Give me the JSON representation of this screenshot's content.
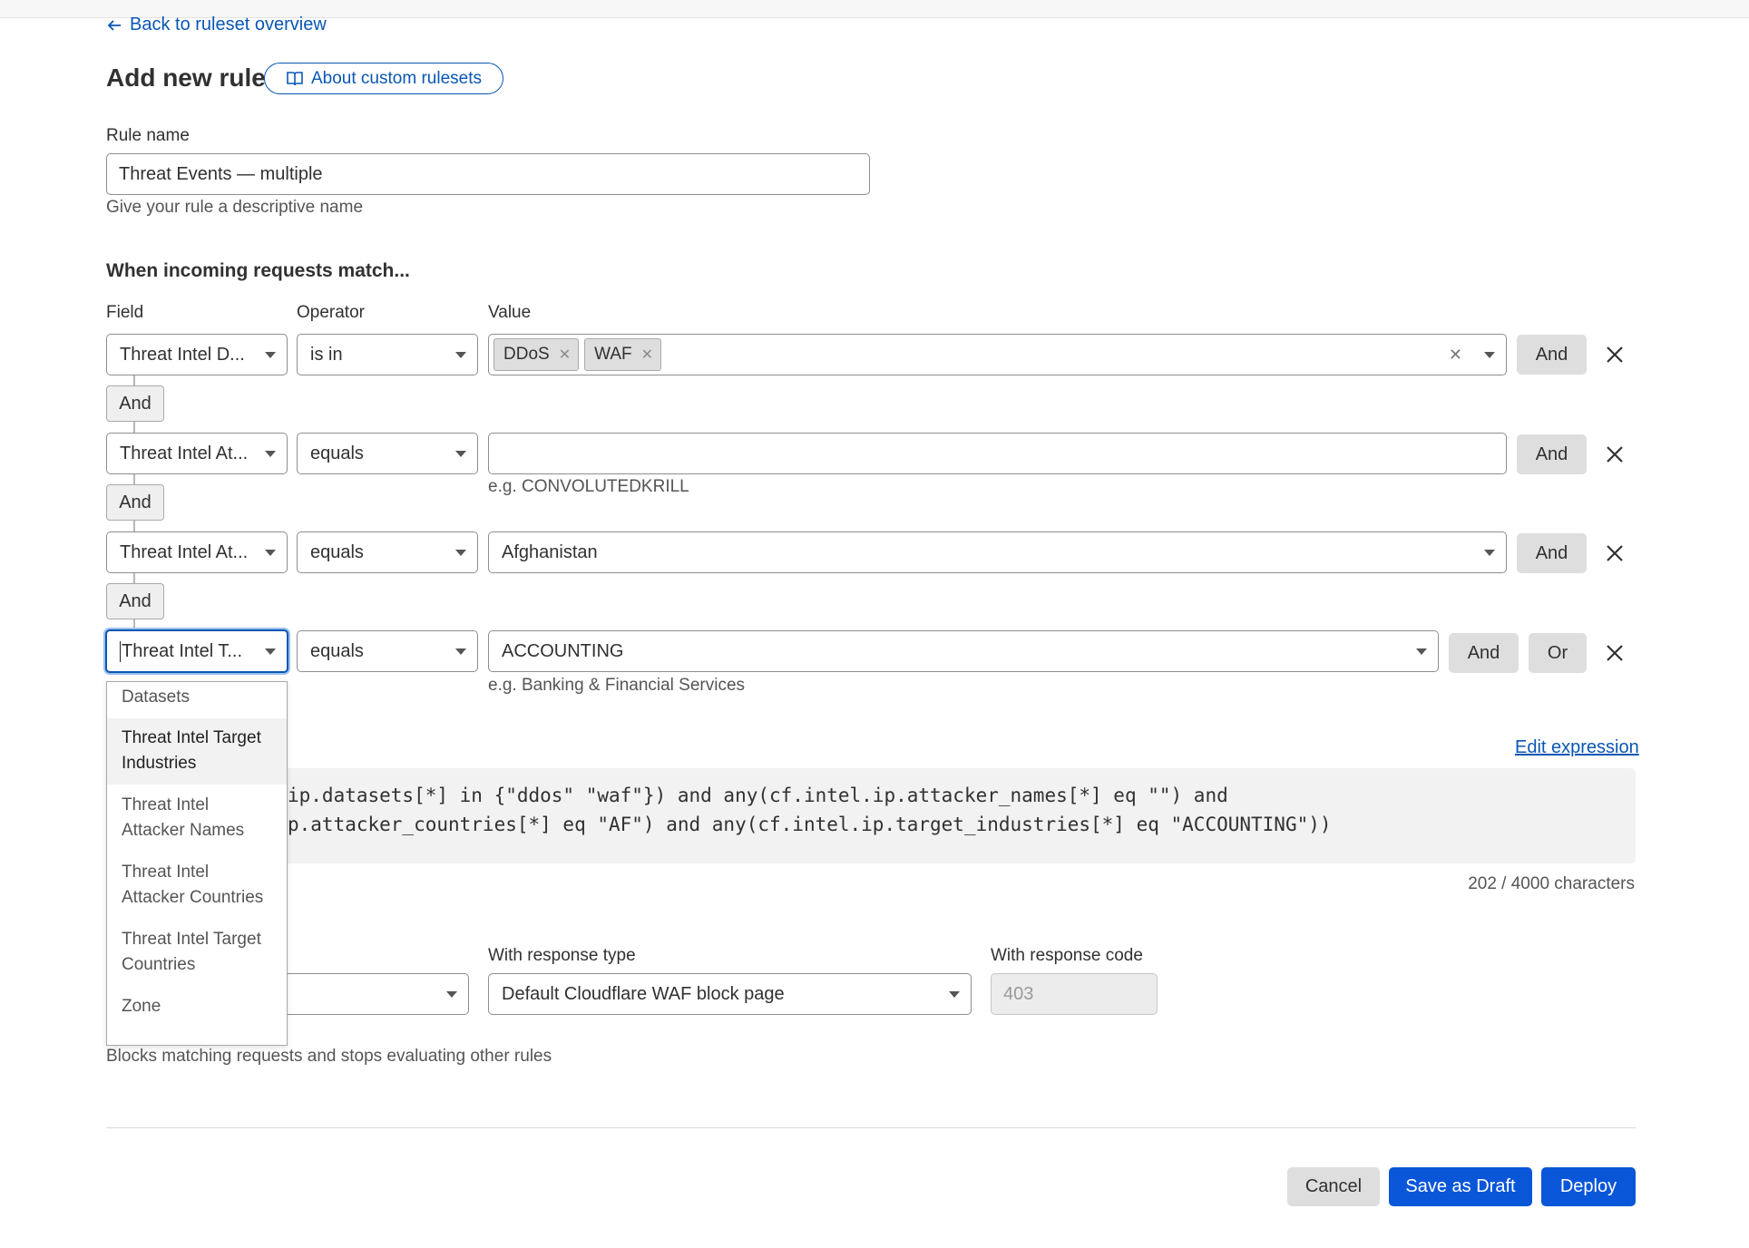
{
  "nav": {
    "back_label": "Back to ruleset overview"
  },
  "header": {
    "title": "Add new rule",
    "about_label": "About custom rulesets"
  },
  "rule_name": {
    "label": "Rule name",
    "value": "Threat Events — multiple",
    "helper": "Give your rule a descriptive name"
  },
  "match": {
    "title": "When incoming requests match...",
    "col_field": "Field",
    "col_operator": "Operator",
    "col_value": "Value",
    "rows": [
      {
        "field": "Threat Intel D...",
        "operator": "is in",
        "tags": [
          "DDoS",
          "WAF"
        ],
        "and_label": "And"
      },
      {
        "field": "Threat Intel At...",
        "operator": "equals",
        "value": "",
        "helper": "e.g. CONVOLUTEDKRILL",
        "and_label": "And"
      },
      {
        "field": "Threat Intel At...",
        "operator": "equals",
        "value": "Afghanistan",
        "and_label": "And"
      },
      {
        "field": "Threat Intel T...",
        "operator": "equals",
        "value": "ACCOUNTING",
        "helper": "e.g. Banking & Financial Services",
        "and_label": "And",
        "or_label": "Or"
      }
    ],
    "connectors": [
      "And",
      "And",
      "And"
    ]
  },
  "field_dropdown": {
    "items": [
      "Datasets",
      "Threat Intel Target Industries",
      "Threat Intel Attacker Names",
      "Threat Intel Attacker Countries",
      "Threat Intel Target Countries",
      "Zone"
    ],
    "active_index": 1
  },
  "expression": {
    "edit_label": "Edit expression",
    "line1": "ip.datasets[*] in {\"ddos\" \"waf\"}) and any(cf.intel.ip.attacker_names[*] eq \"\") and",
    "line2": "p.attacker_countries[*] eq \"AF\") and any(cf.intel.ip.target_industries[*] eq \"ACCOUNTING\"))",
    "char_count": "202 / 4000 characters"
  },
  "action": {
    "response_type_label": "With response type",
    "response_type_value": "Default Cloudflare WAF block page",
    "response_code_label": "With response code",
    "response_code_placeholder": "403",
    "helper": "Blocks matching requests and stops evaluating other rules"
  },
  "footer": {
    "cancel": "Cancel",
    "save_draft": "Save as Draft",
    "deploy": "Deploy"
  },
  "colors": {
    "accent": "#0a56d9",
    "link": "#0a56b4"
  }
}
